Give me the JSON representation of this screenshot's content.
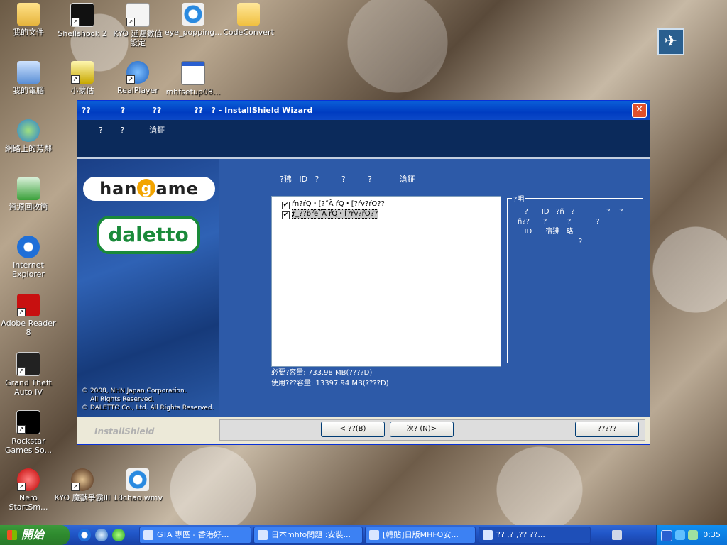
{
  "desktop": {
    "icons": [
      {
        "label": "我的文件"
      },
      {
        "label": "Shellshock 2"
      },
      {
        "label": "KYO 延遲數值設定"
      },
      {
        "label": "eye_popping..."
      },
      {
        "label": "CodeConvert"
      },
      {
        "label": "我的電腦"
      },
      {
        "label": "小蒙估"
      },
      {
        "label": "RealPlayer"
      },
      {
        "label": "mhfsetup08..."
      },
      {
        "label": "網路上的芳鄰"
      },
      {
        "label": "資源回收筒"
      },
      {
        "label": "Internet Explorer"
      },
      {
        "label": "Adobe Reader 8"
      },
      {
        "label": "Grand Theft Auto IV"
      },
      {
        "label": "Rockstar Games So..."
      },
      {
        "label": "Nero StartSm..."
      },
      {
        "label": "KYO 魔獸爭霸III"
      },
      {
        "label": "18chao.wmv"
      }
    ]
  },
  "wizard": {
    "title": "??           ?          ??            ??   ? - InstallShield Wizard",
    "header_text": "?       ?          滄鉦",
    "logos": {
      "hangame": "han",
      "hangame_g": "g",
      "hangame_tail": "ame",
      "daletto": "daletto"
    },
    "copyright": [
      "© 2008, NHN Japan Corporation.",
      "All Rights Reserved.",
      "© DALETTO Co., Ltd. All Rights Reserved."
    ],
    "instruction": "?狒   ID   ?         ?         ?           滄鉦",
    "tree": [
      {
        "label": "ŕn?ŕQ・[?˝Ä ŕQ・[?ŕv?ŕO??",
        "checked": true
      },
      {
        "label": "ŕ_??bŕe˝Ä ŕQ・[?ŕv?ŕO??",
        "checked": true
      }
    ],
    "description_legend": "?明",
    "description_text": "   ?      ID   ?ñ   ?              ?    ?\nñ??      ?         ?           ?\n   ID      宿狒   珞\n                           ?",
    "space_required": "必要?容量: 733.98 MB(????D)",
    "space_available": "使用???容量: 13397.94 MB(????D)",
    "brand": "InstallShield",
    "buttons": {
      "back": "< ??(B)",
      "next": "次? (N)>",
      "cancel": "?????"
    }
  },
  "taskbar": {
    "start_label": "開始",
    "tasks": [
      {
        "label": "GTA 專區 - 香港好..."
      },
      {
        "label": "日本mhfo問題 :安裝..."
      },
      {
        "label": "[轉貼]日版MHFO安..."
      },
      {
        "label": "??  ,?  ,??          ??..."
      }
    ],
    "clock": "0:35"
  }
}
